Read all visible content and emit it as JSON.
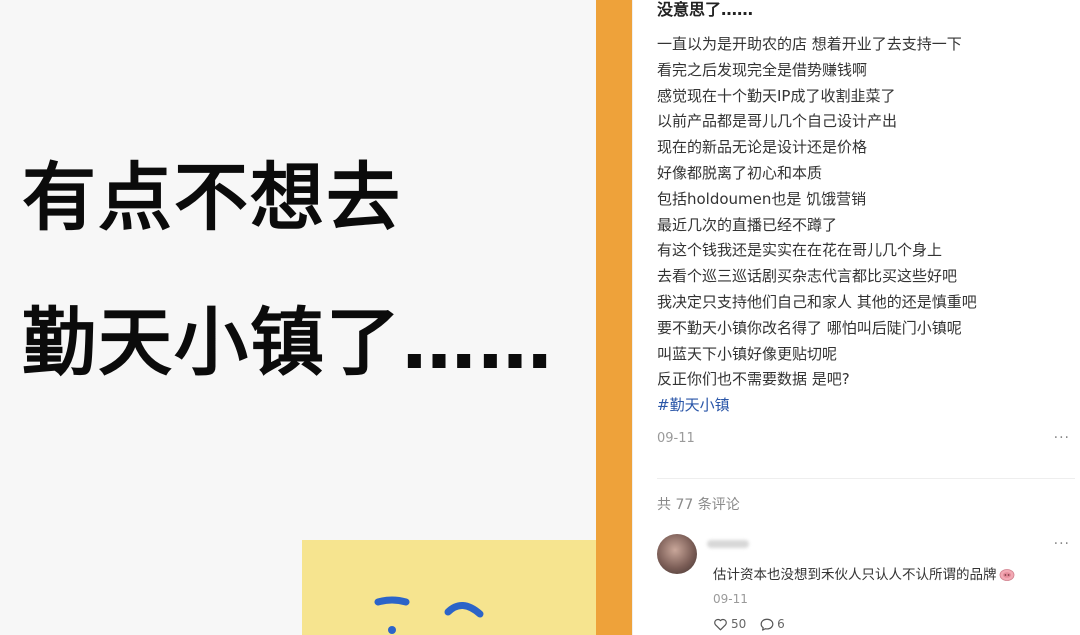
{
  "image": {
    "headline_line1": "有点不想去",
    "headline_line2": "勤天小镇了……"
  },
  "post": {
    "title": "没意思了……",
    "lines": [
      "一直以为是开助农的店 想着开业了去支持一下",
      "看完之后发现完全是借势赚钱啊",
      "感觉现在十个勤天IP成了收割韭菜了",
      "以前产品都是哥儿几个自己设计产出",
      "现在的新品无论是设计还是价格",
      "好像都脱离了初心和本质",
      "包括holdoumen也是 饥饿营销",
      "最近几次的直播已经不蹲了",
      "有这个钱我还是实实在在花在哥儿几个身上",
      "去看个巡三巡话剧买杂志代言都比买这些好吧",
      "我决定只支持他们自己和家人 其他的还是慎重吧",
      "要不勤天小镇你改名得了 哪怕叫后陡门小镇呢",
      "叫蓝天下小镇好像更贴切呢",
      "反正你们也不需要数据 是吧?"
    ],
    "hashtag": "#勤天小镇",
    "date": "09-11",
    "more": "···"
  },
  "comments": {
    "count_label": "共 77 条评论",
    "items": [
      {
        "text": "估计资本也没想到禾伙人只认人不认所谓的品牌",
        "emoji_icon": "pig-nose-emoji-icon",
        "date": "09-11",
        "likes": "50",
        "replies": "6",
        "more": "···"
      }
    ]
  },
  "colors": {
    "accent_orange": "#eea23a",
    "sticky_yellow": "#f6e48f",
    "hashtag_blue": "#2a56a8",
    "doodle_blue": "#2c64c8"
  }
}
